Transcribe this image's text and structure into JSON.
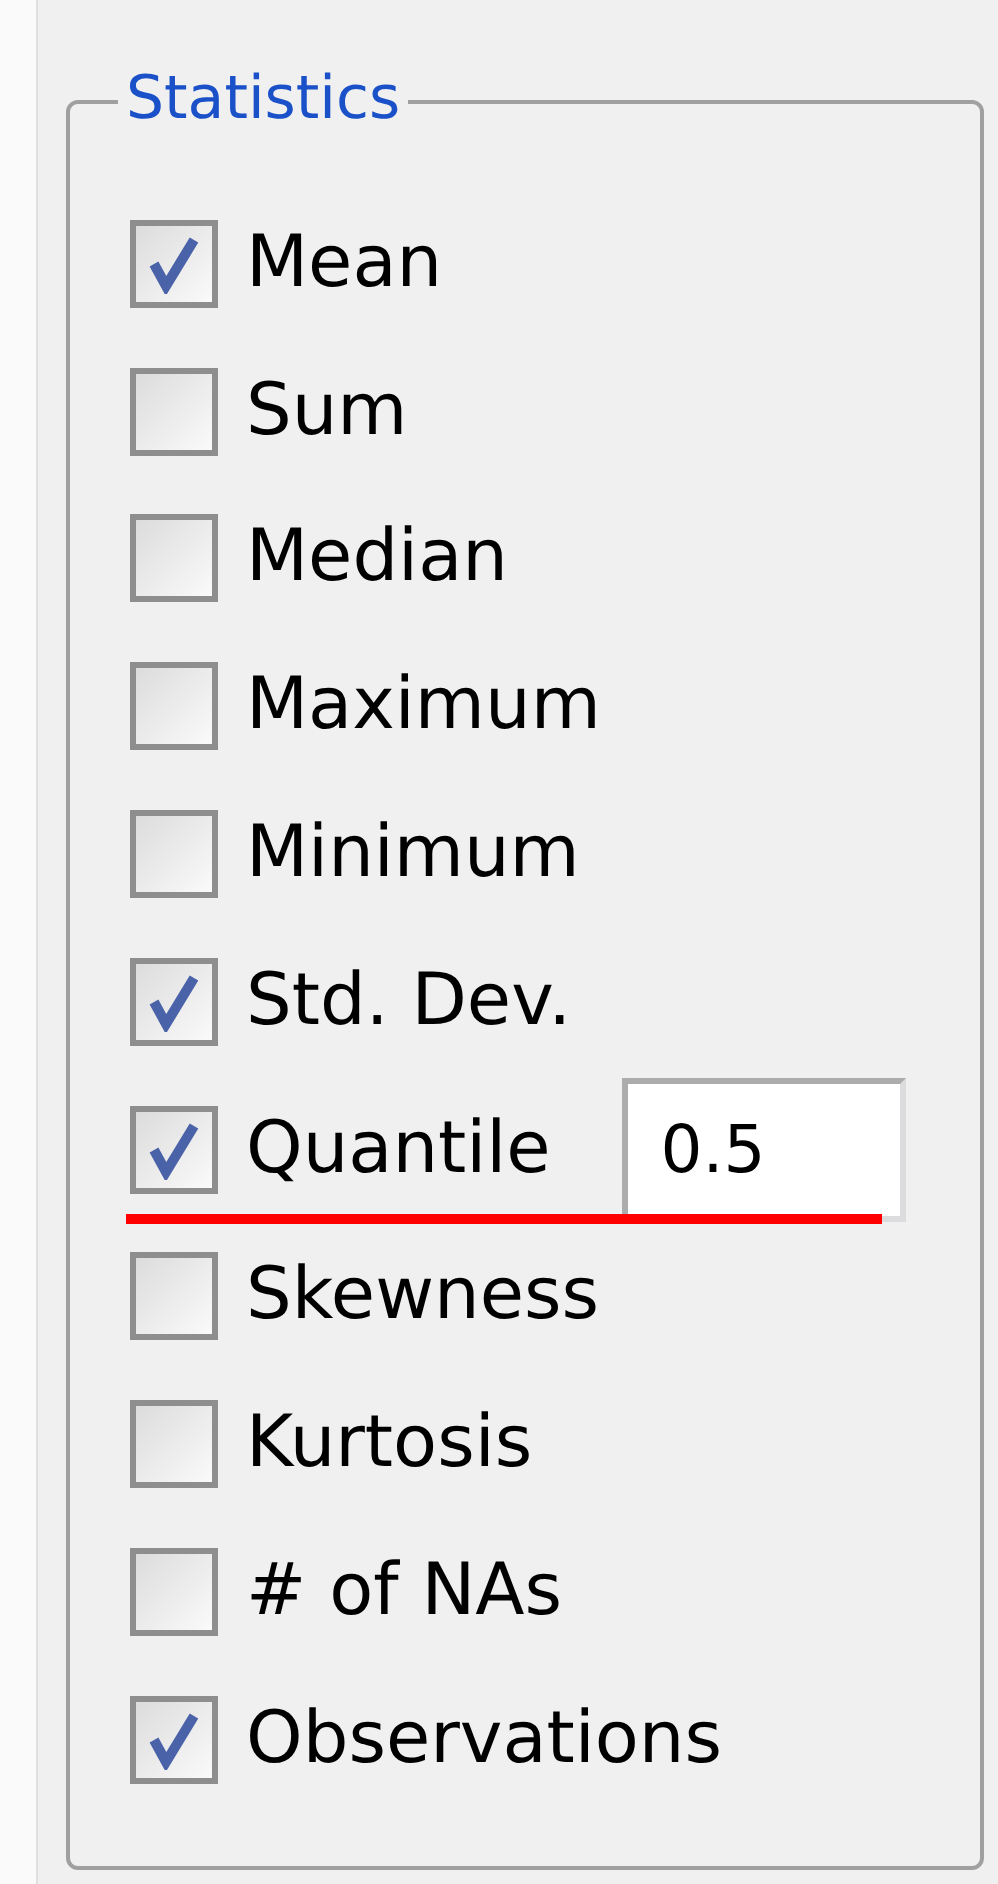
{
  "group": {
    "title": "Statistics"
  },
  "items": [
    {
      "label": "Mean",
      "checked": true,
      "underlined": false
    },
    {
      "label": "Sum",
      "checked": false,
      "underlined": false
    },
    {
      "label": "Median",
      "checked": false,
      "underlined": false
    },
    {
      "label": "Maximum",
      "checked": false,
      "underlined": false
    },
    {
      "label": "Minimum",
      "checked": false,
      "underlined": false
    },
    {
      "label": "Std. Dev.",
      "checked": true,
      "underlined": false
    },
    {
      "label": "Quantile",
      "checked": true,
      "underlined": true,
      "value": "0.5"
    },
    {
      "label": "Skewness",
      "checked": false,
      "underlined": false
    },
    {
      "label": "Kurtosis",
      "checked": false,
      "underlined": false
    },
    {
      "label": "# of NAs",
      "checked": false,
      "underlined": false
    },
    {
      "label": "Observations",
      "checked": true,
      "underlined": false
    }
  ]
}
